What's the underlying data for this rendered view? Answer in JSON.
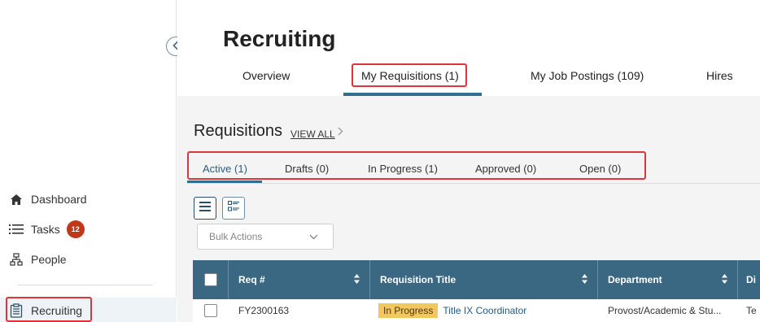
{
  "sidebar": {
    "items": [
      {
        "label": "Dashboard",
        "icon": "home-icon"
      },
      {
        "label": "Tasks",
        "icon": "list-icon",
        "badge": "12"
      },
      {
        "label": "People",
        "icon": "org-chart-icon"
      },
      {
        "label": "Recruiting",
        "icon": "clipboard-icon"
      }
    ],
    "collapse_icon": "chevron-left-icon"
  },
  "header": {
    "title": "Recruiting",
    "tabs": [
      "Overview",
      "My Requisitions (1)",
      "My Job Postings (109)",
      "Hires"
    ]
  },
  "requisitions": {
    "title": "Requisitions",
    "view_all": "VIEW ALL",
    "tabs": [
      "Active (1)",
      "Drafts (0)",
      "In Progress (1)",
      "Approved (0)",
      "Open (0)"
    ],
    "bulk_actions": "Bulk Actions"
  },
  "table": {
    "columns": [
      "Req #",
      "Requisition Title",
      "Department",
      "Di"
    ],
    "rows": [
      {
        "req": "FY2300163",
        "status": "In Progress",
        "title": "Title IX Coordinator",
        "department": "Provost/Academic & Stu...",
        "division": "Te"
      }
    ]
  },
  "colors": {
    "accent": "#2f6f8f",
    "table_header": "#3a6883",
    "highlight": "#e0333c",
    "status": "#f4c660",
    "badge": "#c0371a"
  }
}
